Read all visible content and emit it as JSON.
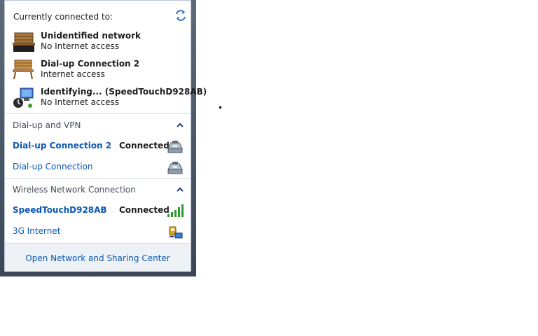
{
  "header": {
    "title": "Currently connected to:"
  },
  "connections": [
    {
      "name": "Unidentified network",
      "status": "No Internet access",
      "icon": "bench-public-network-icon"
    },
    {
      "name": "Dial-up Connection 2",
      "status": "Internet access",
      "icon": "bench-network-icon"
    },
    {
      "name": "Identifying... (SpeedTouchD928AB)",
      "status": "No Internet access",
      "icon": "identifying-network-icon"
    }
  ],
  "dialup": {
    "title": "Dial-up and VPN",
    "items": [
      {
        "name": "Dial-up Connection 2",
        "status": "Connected"
      },
      {
        "name": "Dial-up Connection",
        "status": ""
      }
    ]
  },
  "wireless": {
    "title": "Wireless Network Connection",
    "items": [
      {
        "name": "SpeedTouchD928AB",
        "status": "Connected"
      },
      {
        "name": "3G Internet",
        "status": ""
      }
    ]
  },
  "footer": {
    "link": "Open Network and Sharing Center"
  },
  "colors": {
    "link": "#0b57b6",
    "frame": "#4a5767",
    "footer_bg": "#eef2f7",
    "signal": "#2e9a2e"
  }
}
